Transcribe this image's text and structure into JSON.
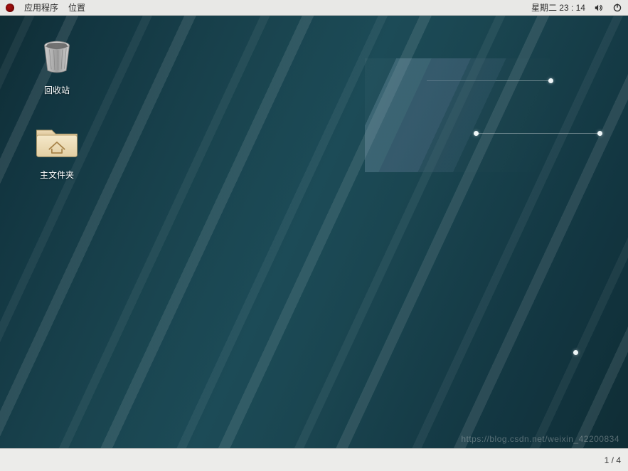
{
  "topbar": {
    "menu_apps": "应用程序",
    "menu_places": "位置",
    "datetime": "星期二  23 : 14"
  },
  "desktop": {
    "icons": [
      {
        "key": "trash",
        "label": "回收站",
        "icon": "trash-icon"
      },
      {
        "key": "home",
        "label": "主文件夹",
        "icon": "home-folder-icon"
      }
    ]
  },
  "bottombar": {
    "page_indicator": "1 / 4"
  },
  "watermark": "https://blog.csdn.net/weixin_42200834"
}
